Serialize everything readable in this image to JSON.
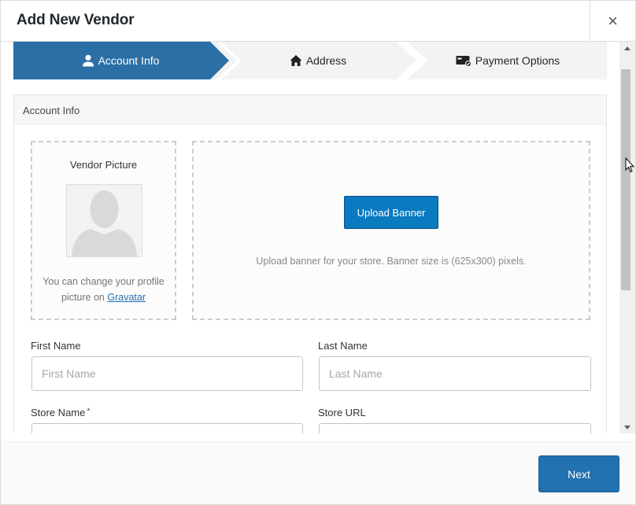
{
  "modal": {
    "title": "Add New Vendor",
    "close_symbol": "×"
  },
  "steps": [
    {
      "label": "Account Info",
      "icon": "user-icon",
      "active": true
    },
    {
      "label": "Address",
      "icon": "home-icon",
      "active": false
    },
    {
      "label": "Payment Options",
      "icon": "payment-icon",
      "active": false
    }
  ],
  "panel": {
    "title": "Account Info"
  },
  "picture": {
    "label": "Vendor Picture",
    "note_prefix": "You can change your profile picture on ",
    "link_text": "Gravatar"
  },
  "banner": {
    "button_label": "Upload Banner",
    "help_text": "Upload banner for your store. Banner size is (625x300) pixels."
  },
  "form": {
    "first_name": {
      "label": "First Name",
      "placeholder": "First Name",
      "value": ""
    },
    "last_name": {
      "label": "Last Name",
      "placeholder": "Last Name",
      "value": ""
    },
    "store_name": {
      "label": "Store Name",
      "required_mark": "*",
      "value": ""
    },
    "store_url": {
      "label": "Store URL",
      "value": ""
    }
  },
  "footer": {
    "next_label": "Next"
  },
  "colors": {
    "accent": "#2271b1",
    "step_active": "#2c6fa6",
    "step_inactive": "#f3f3f3",
    "upload_button": "#0a7ac1"
  }
}
